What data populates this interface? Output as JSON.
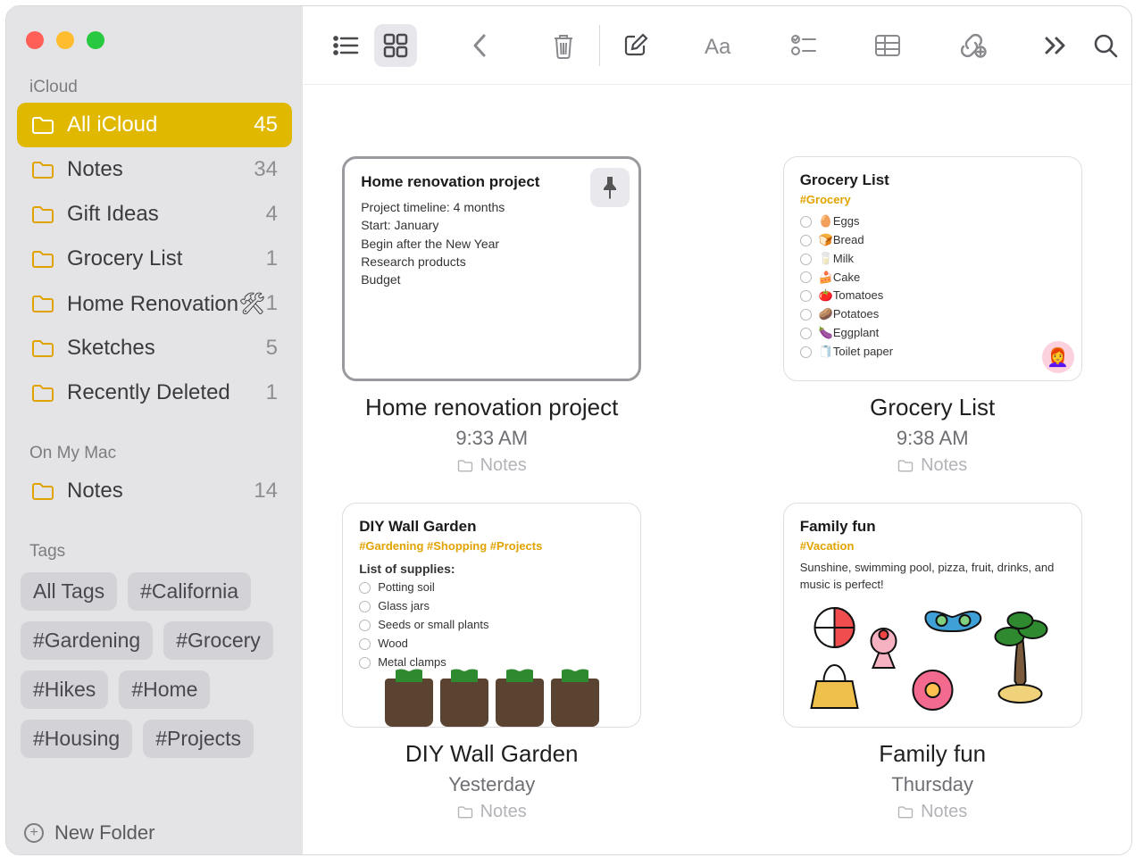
{
  "sidebar": {
    "sections": [
      {
        "label": "iCloud",
        "folders": [
          {
            "name": "All iCloud",
            "count": "45",
            "emoji": "",
            "selected": true
          },
          {
            "name": "Notes",
            "count": "34",
            "emoji": ""
          },
          {
            "name": "Gift Ideas",
            "count": "4",
            "emoji": ""
          },
          {
            "name": "Grocery List",
            "count": "1",
            "emoji": ""
          },
          {
            "name": "Home Renovation",
            "count": "1",
            "emoji": "🛠"
          },
          {
            "name": "Sketches",
            "count": "5",
            "emoji": ""
          },
          {
            "name": "Recently Deleted",
            "count": "1",
            "emoji": ""
          }
        ]
      },
      {
        "label": "On My Mac",
        "folders": [
          {
            "name": "Notes",
            "count": "14",
            "emoji": ""
          }
        ]
      }
    ],
    "tags_label": "Tags",
    "tags": [
      "All Tags",
      "#California",
      "#Gardening",
      "#Grocery",
      "#Hikes",
      "#Home",
      "#Housing",
      "#Projects"
    ],
    "new_folder_label": "New Folder"
  },
  "notes": [
    {
      "title": "Home renovation project",
      "tags": "",
      "body_lines": [
        "Project timeline: 4 months",
        "Start: January",
        "Begin after the New Year",
        "Research products",
        "Budget"
      ],
      "checklist": [],
      "pinned": true,
      "selected": true,
      "avatar": false,
      "sketch": "none",
      "meta_title": "Home renovation project",
      "meta_time": "9:33 AM",
      "meta_folder": "Notes"
    },
    {
      "title": "Grocery List",
      "tags": "#Grocery",
      "body_lines": [],
      "checklist": [
        "🥚Eggs",
        "🍞Bread",
        "🥛Milk",
        "🍰Cake",
        "🍅Tomatoes",
        "🥔Potatoes",
        "🍆Eggplant",
        "🧻Toilet paper"
      ],
      "pinned": false,
      "selected": false,
      "avatar": true,
      "sketch": "none",
      "meta_title": "Grocery List",
      "meta_time": "9:38 AM",
      "meta_folder": "Notes"
    },
    {
      "title": "DIY Wall Garden",
      "tags": "#Gardening #Shopping #Projects",
      "body_lines": [
        "List of supplies:"
      ],
      "checklist": [
        "Potting soil",
        "Glass jars",
        "Seeds or small plants",
        "Wood",
        "Metal clamps"
      ],
      "pinned": false,
      "selected": false,
      "avatar": false,
      "sketch": "plants",
      "meta_title": "DIY Wall Garden",
      "meta_time": "Yesterday",
      "meta_folder": "Notes"
    },
    {
      "title": "Family fun",
      "tags": "#Vacation",
      "body_lines": [
        "Sunshine, swimming pool, pizza, fruit, drinks, and music is perfect!"
      ],
      "checklist": [],
      "pinned": false,
      "selected": false,
      "avatar": false,
      "sketch": "stickers",
      "meta_title": "Family fun",
      "meta_time": "Thursday",
      "meta_folder": "Notes"
    }
  ]
}
